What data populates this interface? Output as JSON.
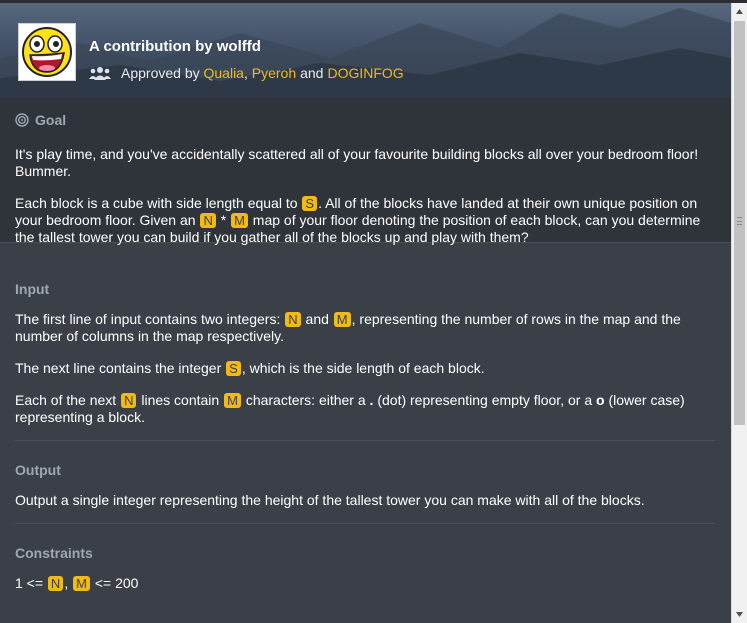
{
  "header": {
    "author_text": "A contribution by wolffd",
    "approved_prefix": "Approved by",
    "approvers": [
      "Qualia",
      "Pyeroh",
      "DOGINFOG"
    ],
    "comma": ",",
    "and_text": "and"
  },
  "goal": {
    "title": "Goal",
    "p1": "It's play time, and you've accidentally scattered all of your favourite building blocks all over your bedroom floor! Bummer.",
    "p2_a": "Each block is a cube with side length equal to",
    "p2_b": ". All of the blocks have landed at their own unique position on your bedroom floor. Given an",
    "p2_c": "*",
    "p2_d": "map of your floor denoting the position of each block, can you determine the tallest tower you can build if you gather all of the blocks up and play with them?"
  },
  "vars": {
    "S": "S",
    "N": "N",
    "M": "M"
  },
  "input": {
    "title": "Input",
    "l1_a": "The first line of input contains two integers:",
    "l1_b": "and",
    "l1_c": ", representing the number of rows in the map and the number of columns in the map respectively.",
    "l2_a": "The next line contains the integer",
    "l2_b": ", which is the side length of each block.",
    "l3_a": "Each of the next",
    "l3_b": "lines contain",
    "l3_c": "characters: either a",
    "l3_dot": ".",
    "l3_d": "(dot) representing empty floor, or a",
    "l3_o": "o",
    "l3_e": "(lower case) representing a block."
  },
  "output": {
    "title": "Output",
    "text": "Output a single integer representing the height of the tallest tower you can make with all of the blocks."
  },
  "constraints": {
    "title": "Constraints",
    "line_a": "1 <=",
    "line_b": ",",
    "line_c": "<= 200"
  },
  "colors": {
    "accent": "#f2bb13",
    "background": "#3b4048",
    "goal_background": "#2f343b",
    "section_title": "#9ea7b2"
  }
}
